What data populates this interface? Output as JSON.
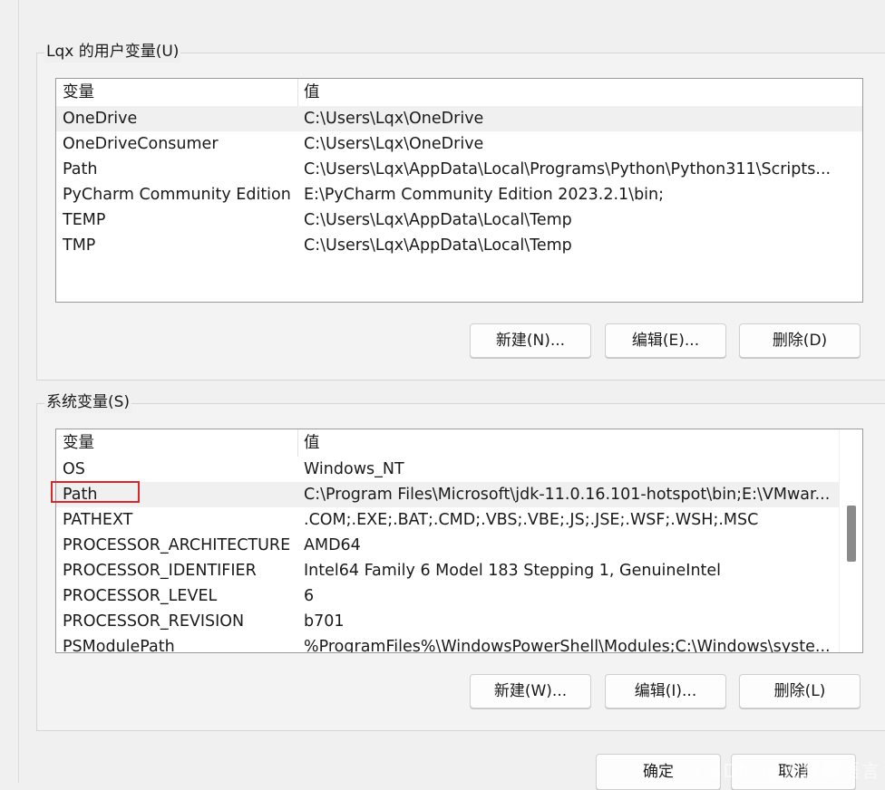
{
  "user_vars": {
    "title": "Lqx 的用户变量(U)",
    "columns": {
      "name": "变量",
      "value": "值"
    },
    "rows": [
      {
        "name": "OneDrive",
        "value": "C:\\Users\\Lqx\\OneDrive",
        "selected": true
      },
      {
        "name": "OneDriveConsumer",
        "value": "C:\\Users\\Lqx\\OneDrive",
        "selected": false
      },
      {
        "name": "Path",
        "value": "C:\\Users\\Lqx\\AppData\\Local\\Programs\\Python\\Python311\\Scripts...",
        "selected": false
      },
      {
        "name": "PyCharm Community Edition",
        "value": "E:\\PyCharm Community Edition 2023.2.1\\bin;",
        "selected": false
      },
      {
        "name": "TEMP",
        "value": "C:\\Users\\Lqx\\AppData\\Local\\Temp",
        "selected": false
      },
      {
        "name": "TMP",
        "value": "C:\\Users\\Lqx\\AppData\\Local\\Temp",
        "selected": false
      }
    ],
    "buttons": {
      "new": "新建(N)...",
      "edit": "编辑(E)...",
      "delete": "删除(D)"
    }
  },
  "system_vars": {
    "title": "系统变量(S)",
    "columns": {
      "name": "变量",
      "value": "值"
    },
    "rows": [
      {
        "name": "OS",
        "value": "Windows_NT",
        "selected": false
      },
      {
        "name": "Path",
        "value": "C:\\Program Files\\Microsoft\\jdk-11.0.16.101-hotspot\\bin;E:\\VMwar...",
        "selected": true
      },
      {
        "name": "PATHEXT",
        "value": ".COM;.EXE;.BAT;.CMD;.VBS;.VBE;.JS;.JSE;.WSF;.WSH;.MSC",
        "selected": false
      },
      {
        "name": "PROCESSOR_ARCHITECTURE",
        "value": "AMD64",
        "selected": false
      },
      {
        "name": "PROCESSOR_IDENTIFIER",
        "value": "Intel64 Family 6 Model 183 Stepping 1, GenuineIntel",
        "selected": false
      },
      {
        "name": "PROCESSOR_LEVEL",
        "value": "6",
        "selected": false
      },
      {
        "name": "PROCESSOR_REVISION",
        "value": "b701",
        "selected": false
      },
      {
        "name": "PSModulePath",
        "value": "%ProgramFiles%\\WindowsPowerShell\\Modules;C:\\Windows\\syste...",
        "selected": false
      }
    ],
    "buttons": {
      "new": "新建(W)...",
      "edit": "编辑(I)...",
      "delete": "删除(L)"
    }
  },
  "footer": {
    "ok": "确定",
    "cancel": "取消"
  },
  "annotation": {
    "highlight_color": "#d9262b"
  },
  "watermark": "CSDN @大数据语言"
}
